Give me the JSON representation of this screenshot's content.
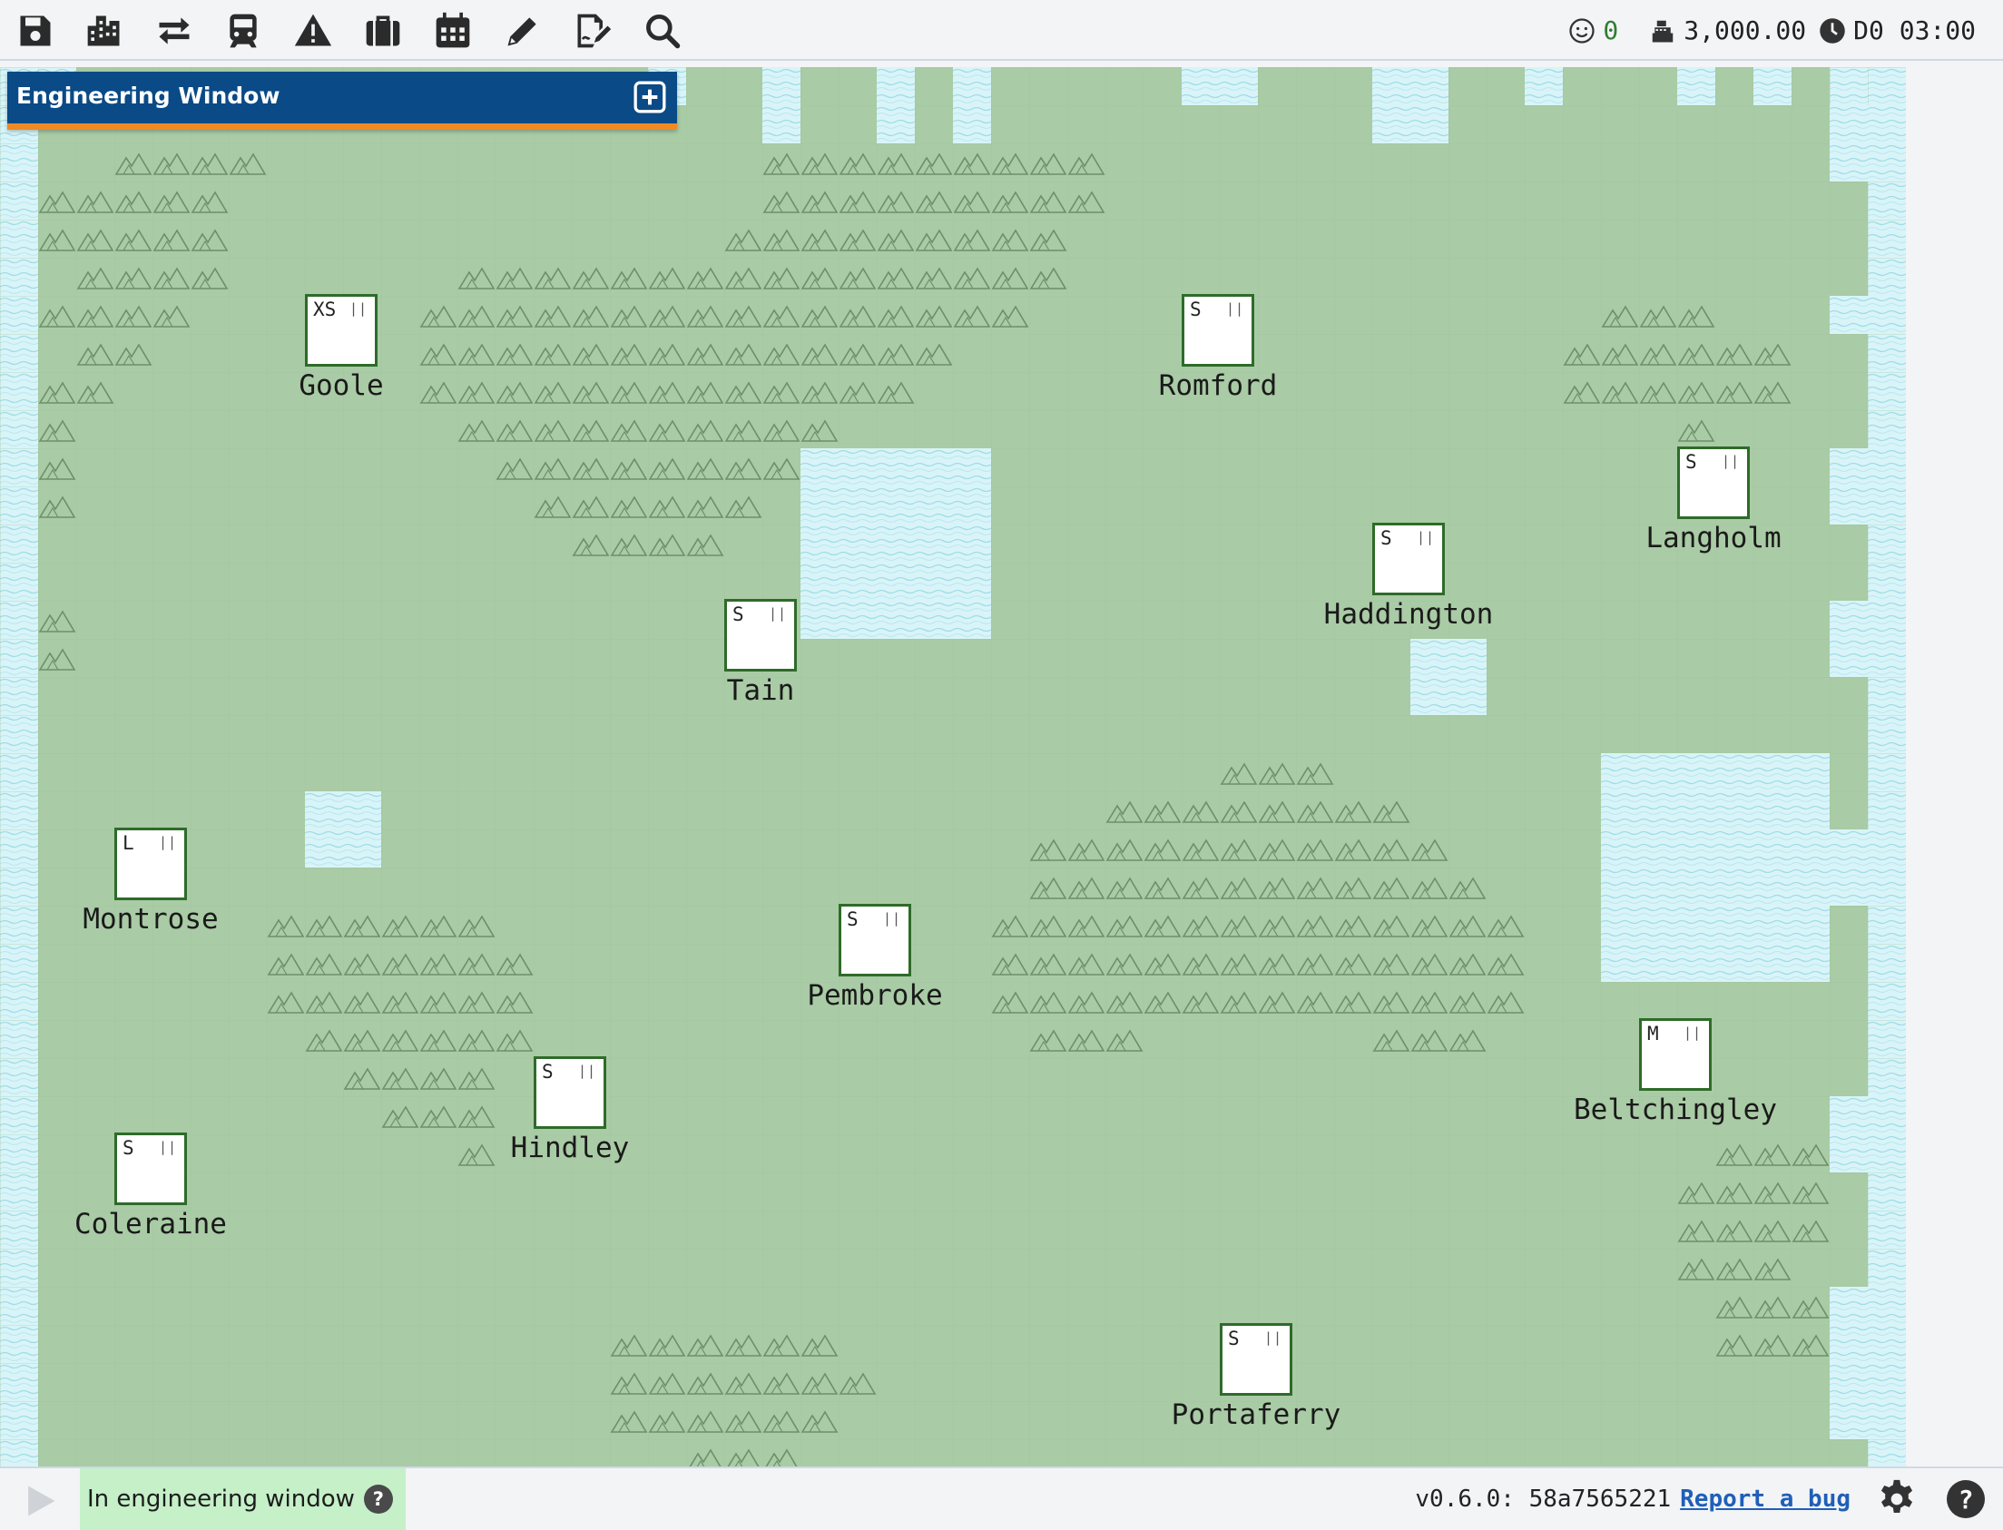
{
  "toolbar": {
    "buttons": [
      {
        "icon": "save-icon"
      },
      {
        "icon": "city-icon"
      },
      {
        "icon": "swap-arrows-icon"
      },
      {
        "icon": "train-icon"
      },
      {
        "icon": "warning-icon"
      },
      {
        "icon": "briefcase-icon"
      },
      {
        "icon": "calendar-icon"
      },
      {
        "icon": "pencil-icon"
      },
      {
        "icon": "signature-icon"
      },
      {
        "icon": "search-icon"
      }
    ]
  },
  "status": {
    "happiness": "0",
    "money": "3,000.00",
    "clock": "D0 03:00"
  },
  "engineering_window": {
    "title": "Engineering Window"
  },
  "stations": [
    {
      "name": "Goole",
      "size": "XS"
    },
    {
      "name": "Romford",
      "size": "S"
    },
    {
      "name": "Langholm",
      "size": "S"
    },
    {
      "name": "Haddington",
      "size": "S"
    },
    {
      "name": "Tain",
      "size": "S"
    },
    {
      "name": "Montrose",
      "size": "L"
    },
    {
      "name": "Pembroke",
      "size": "S"
    },
    {
      "name": "Beltchingley",
      "size": "M"
    },
    {
      "name": "Hindley",
      "size": "S"
    },
    {
      "name": "Coleraine",
      "size": "S"
    },
    {
      "name": "Portaferry",
      "size": "S"
    }
  ],
  "bottom": {
    "mode_label": "In engineering window",
    "help_glyph": "?",
    "version": "v0.6.0: 58a7565221",
    "report_link": "Report a bug",
    "help_button": "?"
  },
  "colors": {
    "land": "#a9cba5",
    "water": "#d9f4f8",
    "station_border": "#2e6b2a",
    "header": "#0a4a86",
    "header_accent": "#f08a24",
    "mode_badge": "#c5f0c8"
  }
}
